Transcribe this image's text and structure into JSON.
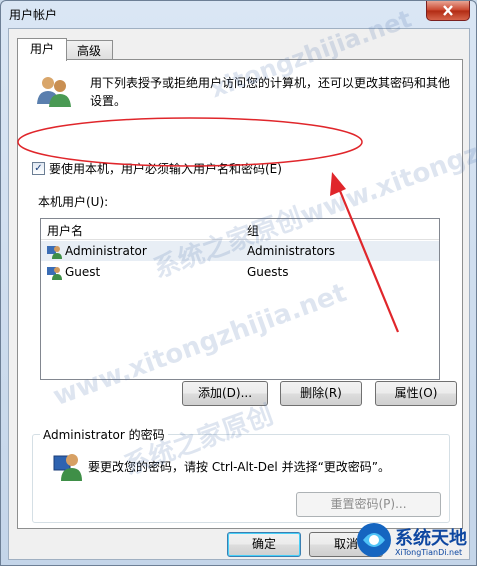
{
  "window": {
    "title": "用户帐户"
  },
  "tabs": [
    {
      "label": "用户"
    },
    {
      "label": "高级"
    }
  ],
  "description": "用下列表授予或拒绝用户访问您的计算机，还可以更改其密码和其他设置。",
  "checkbox": {
    "label": "要使用本机，用户必须输入用户名和密码(E)",
    "checked": true
  },
  "users_label": "本机用户(U):",
  "table": {
    "columns": [
      "用户名",
      "组"
    ],
    "rows": [
      {
        "name": "Administrator",
        "group": "Administrators"
      },
      {
        "name": "Guest",
        "group": "Guests"
      }
    ]
  },
  "buttons": {
    "add": "添加(D)...",
    "remove": "删除(R)",
    "properties": "属性(O)",
    "reset_password": "重置密码(P)...",
    "ok": "确定",
    "cancel": "取消"
  },
  "password_group": {
    "title": "Administrator 的密码",
    "text": "要更改您的密码，请按 Ctrl-Alt-Del 并选择“更改密码”。"
  },
  "watermarks": [
    "系统之家原创www.xitongzhijia.net",
    "xitongzhijia.net",
    "www.xitongzhijia.net",
    "系统之家原创"
  ],
  "logo": {
    "text_cn": "系统天地",
    "text_en": "XiTongTianDi.net"
  },
  "colors": {
    "annotation": "#e0262b",
    "selection": "#cce8ff"
  }
}
